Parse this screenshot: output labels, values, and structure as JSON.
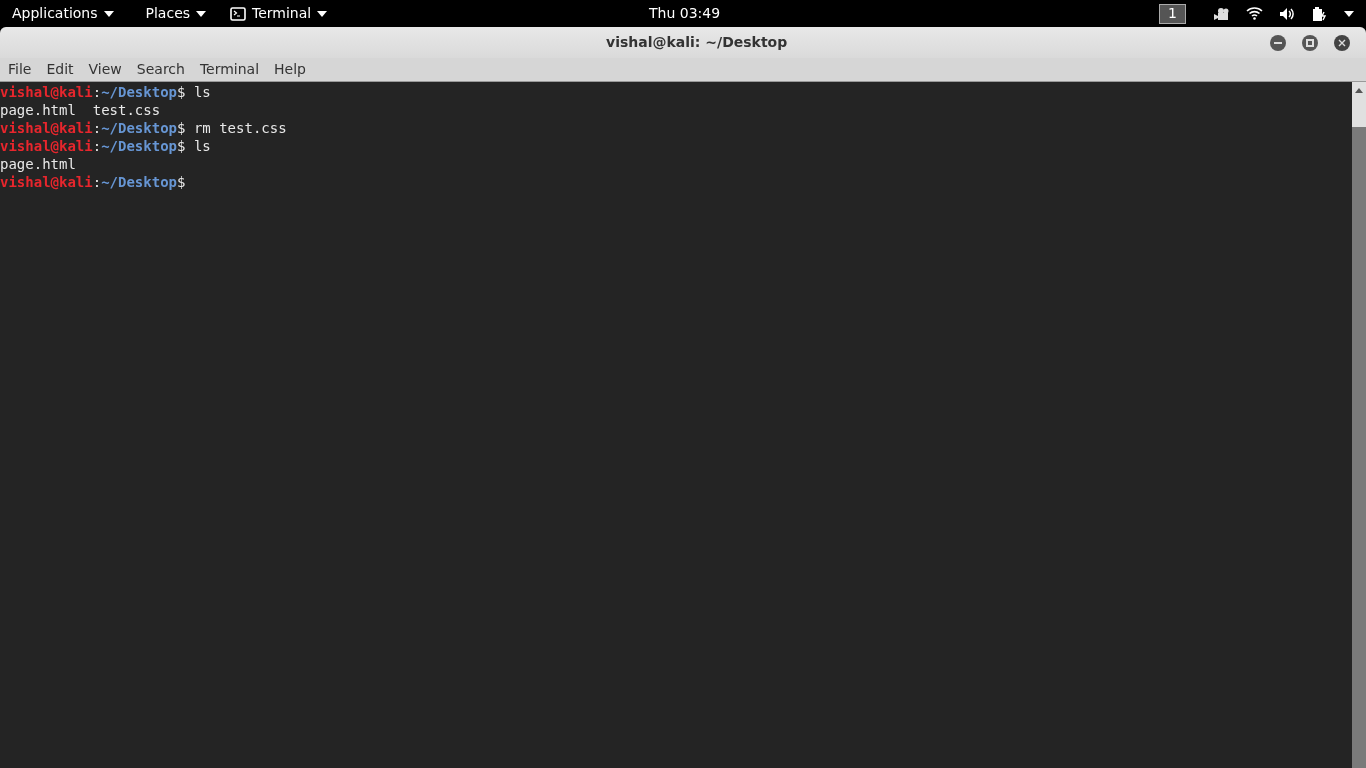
{
  "top_bar": {
    "menus": [
      {
        "label": "Applications",
        "kind": "text"
      },
      {
        "label": "Places",
        "kind": "text"
      },
      {
        "label": "Terminal",
        "kind": "terminal"
      }
    ],
    "clock": "Thu 03:49",
    "workspace": "1"
  },
  "window": {
    "title": "vishal@kali: ~/Desktop",
    "menu": [
      "File",
      "Edit",
      "View",
      "Search",
      "Terminal",
      "Help"
    ],
    "lines": [
      {
        "kind": "prompt",
        "user": "vishal@kali",
        "sep": ":",
        "path": "~/Desktop",
        "sign": "$",
        "command": " ls"
      },
      {
        "kind": "output",
        "text": "page.html  test.css"
      },
      {
        "kind": "prompt",
        "user": "vishal@kali",
        "sep": ":",
        "path": "~/Desktop",
        "sign": "$",
        "command": " rm test.css"
      },
      {
        "kind": "prompt",
        "user": "vishal@kali",
        "sep": ":",
        "path": "~/Desktop",
        "sign": "$",
        "command": " ls"
      },
      {
        "kind": "output",
        "text": "page.html"
      },
      {
        "kind": "prompt",
        "user": "vishal@kali",
        "sep": ":",
        "path": "~/Desktop",
        "sign": "$"
      }
    ]
  }
}
